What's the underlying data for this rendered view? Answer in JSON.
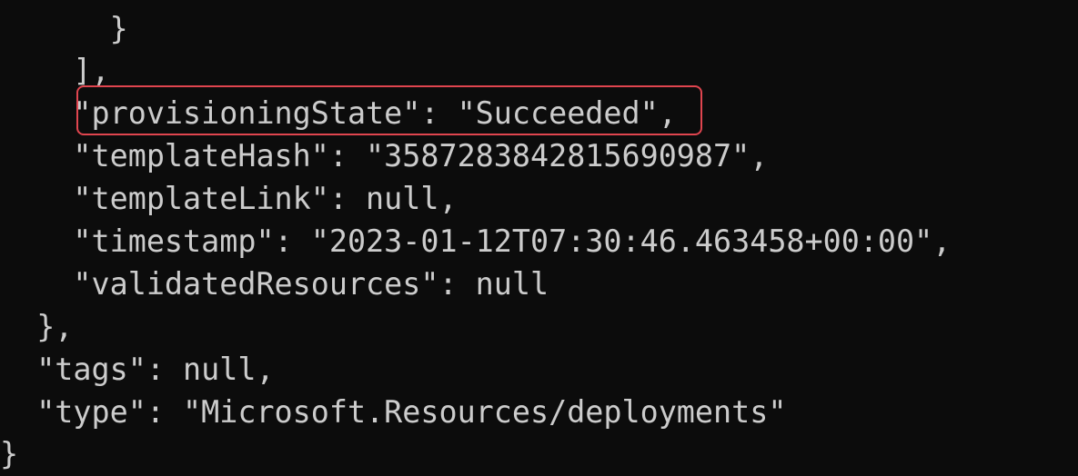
{
  "terminal": {
    "lines": [
      "      }",
      "    ],",
      "    \"provisioningState\": \"Succeeded\",",
      "    \"templateHash\": \"3587283842815690987\",",
      "    \"templateLink\": null,",
      "    \"timestamp\": \"2023-01-12T07:30:46.463458+00:00\",",
      "    \"validatedResources\": null",
      "  },",
      "  \"tags\": null,",
      "  \"type\": \"Microsoft.Resources/deployments\"",
      "}"
    ]
  },
  "colors": {
    "background": "#0c0c0c",
    "text": "#cccccc",
    "highlight_border": "#e0454f"
  }
}
